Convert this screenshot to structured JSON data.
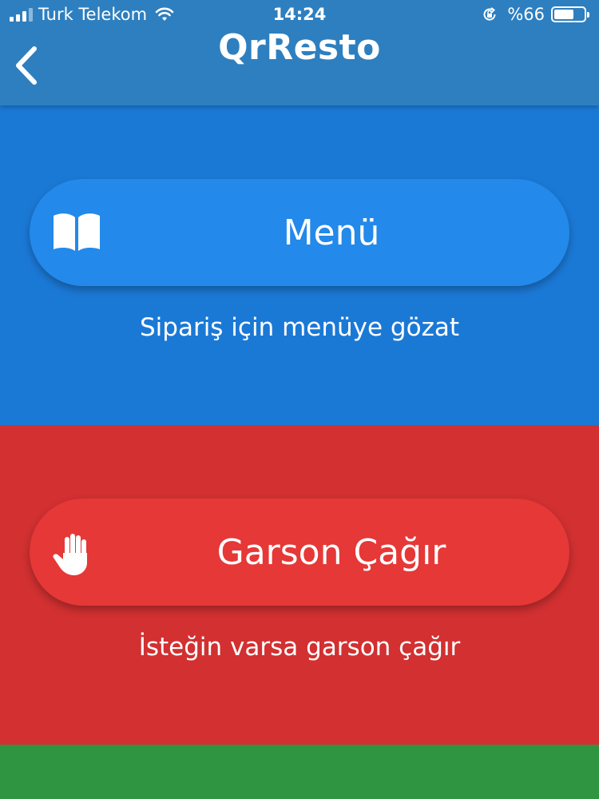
{
  "status_bar": {
    "carrier": "Turk Telekom",
    "time": "14:24",
    "battery_text": "%66",
    "battery_level": 0.66
  },
  "header": {
    "title": "QrResto",
    "back_icon": "chevron-left-icon"
  },
  "menu_section": {
    "button_label": "Menü",
    "icon": "open-book-icon",
    "subtitle": "Sipariş için menüye gözat",
    "color": "#1b79d6",
    "button_color": "#2389ea"
  },
  "waiter_section": {
    "button_label": "Garson Çağır",
    "icon": "raised-hand-icon",
    "subtitle": "İsteğin varsa garson çağır",
    "color": "#d23031",
    "button_color": "#e53837"
  },
  "bottom_section": {
    "color": "#2f9540"
  }
}
